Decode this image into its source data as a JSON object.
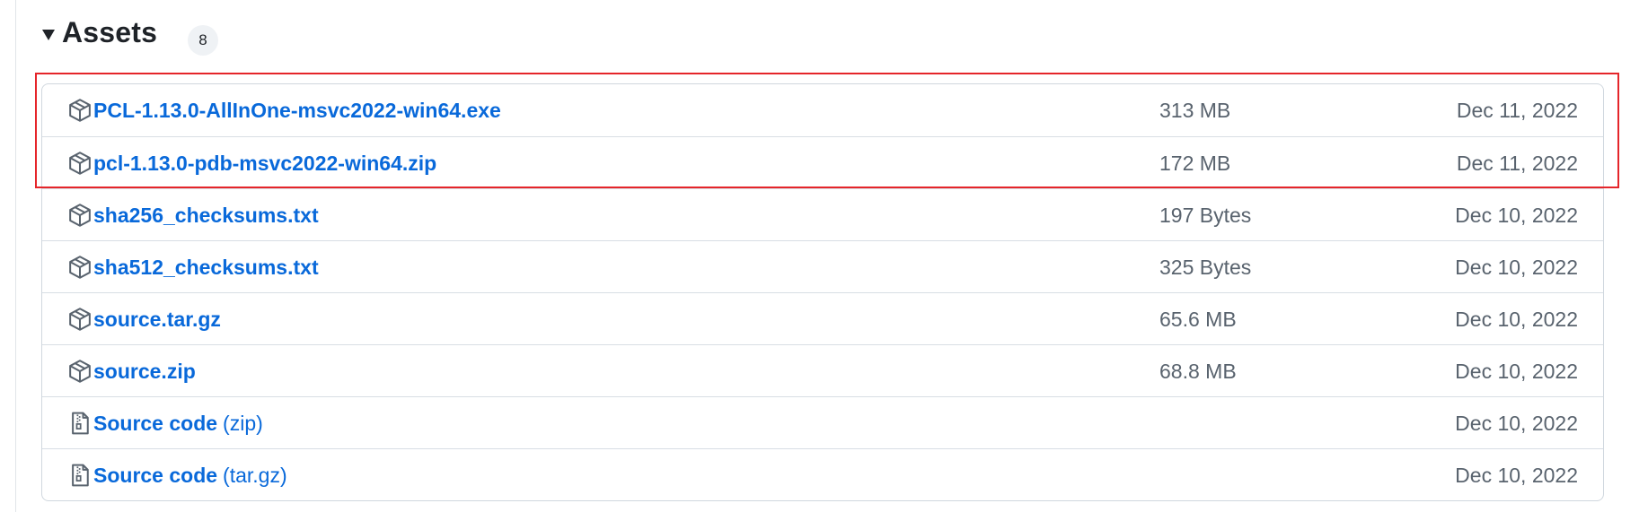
{
  "assets": {
    "title": "Assets",
    "count": "8",
    "items": [
      {
        "name": "PCL-1.13.0-AllInOne-msvc2022-win64.exe",
        "suffix": "",
        "size": "313 MB",
        "date": "Dec 11, 2022",
        "icon": "package-icon"
      },
      {
        "name": "pcl-1.13.0-pdb-msvc2022-win64.zip",
        "suffix": "",
        "size": "172 MB",
        "date": "Dec 11, 2022",
        "icon": "package-icon"
      },
      {
        "name": "sha256_checksums.txt",
        "suffix": "",
        "size": "197 Bytes",
        "date": "Dec 10, 2022",
        "icon": "package-icon"
      },
      {
        "name": "sha512_checksums.txt",
        "suffix": "",
        "size": "325 Bytes",
        "date": "Dec 10, 2022",
        "icon": "package-icon"
      },
      {
        "name": "source.tar.gz",
        "suffix": "",
        "size": "65.6 MB",
        "date": "Dec 10, 2022",
        "icon": "package-icon"
      },
      {
        "name": "source.zip",
        "suffix": "",
        "size": "68.8 MB",
        "date": "Dec 10, 2022",
        "icon": "package-icon"
      },
      {
        "name": "Source code",
        "suffix": "(zip)",
        "size": "",
        "date": "Dec 10, 2022",
        "icon": "file-zip-icon"
      },
      {
        "name": "Source code",
        "suffix": "(tar.gz)",
        "size": "",
        "date": "Dec 10, 2022",
        "icon": "file-zip-icon"
      }
    ]
  },
  "colors": {
    "link": "#0969da",
    "muted": "#59636e",
    "highlight": "#e5252a"
  }
}
